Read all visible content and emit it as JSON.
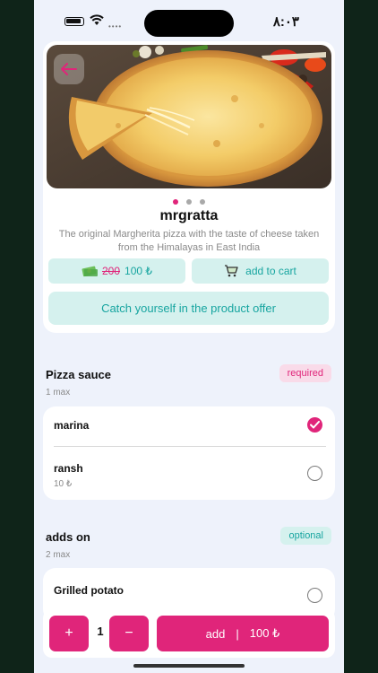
{
  "status_bar": {
    "time": "٨:٠٣"
  },
  "product": {
    "name": "mrgratta",
    "description": "The original Margherita pizza with the taste of cheese taken from the Himalayas in East India",
    "old_price": "200",
    "price": "100 ₺",
    "add_to_cart_label": "add to cart",
    "offer_label": "Catch yourself in the product offer",
    "carousel": {
      "count": 3,
      "active": 1
    }
  },
  "sections": [
    {
      "title": "Pizza sauce",
      "limit": "1 max",
      "badge": "required",
      "options": [
        {
          "name": "marina",
          "price": "",
          "selected": true
        },
        {
          "name": "ransh",
          "price": "10 ₺",
          "selected": false
        }
      ]
    },
    {
      "title": "adds on",
      "limit": "2 max",
      "badge": "optional",
      "options": [
        {
          "name": "Grilled potato",
          "price": "",
          "selected": false
        }
      ]
    }
  ],
  "bottom_bar": {
    "plus": "+",
    "quantity": "1",
    "minus": "−",
    "add_label": "add",
    "separator": "|",
    "total": "100 ₺"
  },
  "colors": {
    "accent": "#e0257a",
    "teal": "#17a5a0",
    "teal_bg": "#d5f1ee",
    "page_bg": "#eef2fb"
  }
}
